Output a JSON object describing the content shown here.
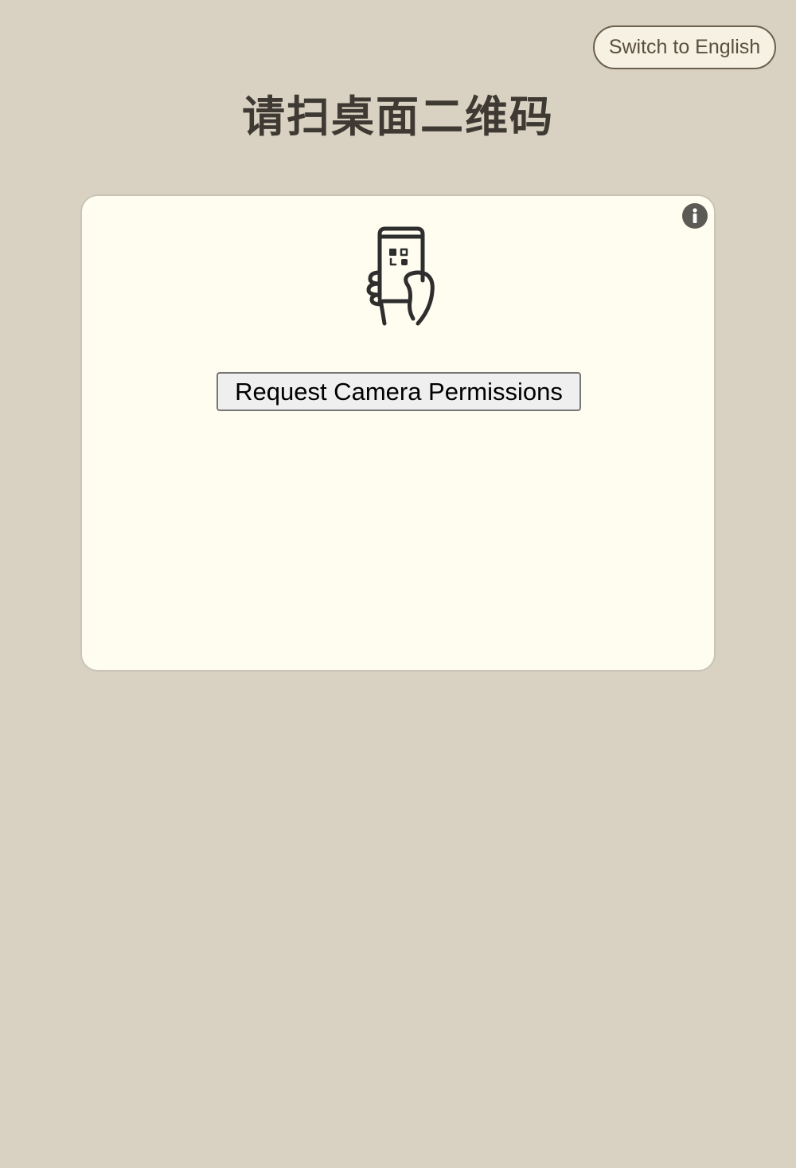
{
  "header": {
    "language_toggle_label": "Switch to English",
    "title": "请扫桌面二维码"
  },
  "scanner": {
    "info_icon": "info-icon",
    "illustration_icon": "phone-scan-qr-icon",
    "request_button_label": "Request Camera Permissions"
  },
  "colors": {
    "page_background": "#d9d2c2",
    "card_background": "#fffdf0",
    "title_text": "#3e3a33",
    "toggle_border": "#6b604f",
    "icon_dark": "#2e2e2e"
  }
}
